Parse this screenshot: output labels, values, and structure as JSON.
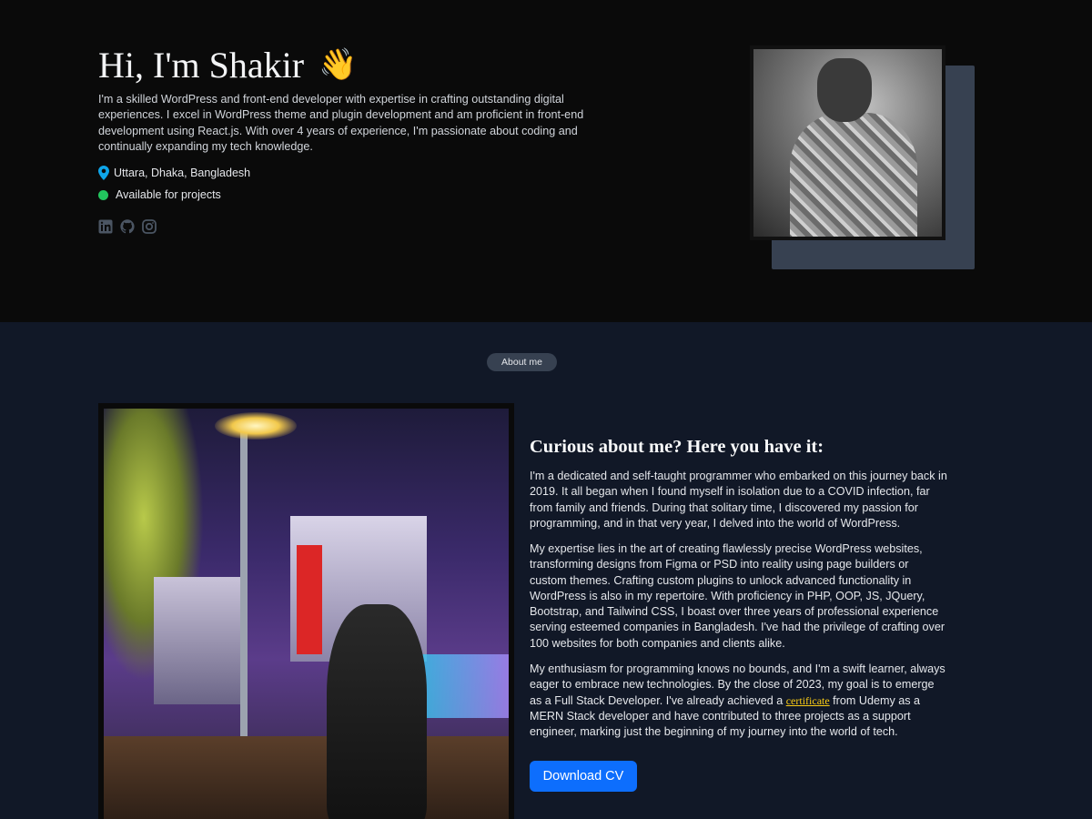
{
  "hero": {
    "title": "Hi, I'm Shakir",
    "wave_emoji": "👋",
    "description": "I'm a skilled WordPress and front-end developer with expertise in crafting outstanding digital experiences. I excel in WordPress theme and plugin development and am proficient in front-end development using React.js. With over 4 years of experience, I'm passionate about coding and continually expanding my tech knowledge.",
    "location": "Uttara, Dhaka, Bangladesh",
    "availability": "Available for projects",
    "socials": [
      {
        "icon": "linkedin-icon"
      },
      {
        "icon": "github-icon"
      },
      {
        "icon": "instagram-icon"
      }
    ]
  },
  "about": {
    "pill": "About me",
    "heading": "Curious about me? Here you have it:",
    "p1": "I'm a dedicated and self-taught programmer who embarked on this journey back in 2019. It all began when I found myself in isolation due to a COVID infection, far from family and friends. During that solitary time, I discovered my passion for programming, and in that very year, I delved into the world of WordPress.",
    "p2": "My expertise lies in the art of creating flawlessly precise WordPress websites, transforming designs from Figma or PSD into reality using page builders or custom themes. Crafting custom plugins to unlock advanced functionality in WordPress is also in my repertoire. With proficiency in PHP, OOP, JS, JQuery, Bootstrap, and Tailwind CSS, I boast over three years of professional experience serving esteemed companies in Bangladesh. I've had the privilege of crafting over 100 websites for both companies and clients alike.",
    "p3_before": "My enthusiasm for programming knows no bounds, and I'm a swift learner, always eager to embrace new technologies. By the close of 2023, my goal is to emerge as a Full Stack Developer. I've already achieved a ",
    "p3_link": "certificate",
    "p3_after": " from Udemy as a MERN Stack developer and have contributed to three projects as a support engineer, marking just the beginning of my journey into the world of tech.",
    "cv_button": "Download CV"
  },
  "colors": {
    "hero_bg": "#0a0a0a",
    "about_bg": "#111827",
    "accent_button": "#0d6efd",
    "available_dot": "#22c55e",
    "location_pin": "#0ea5e9",
    "link": "#facc15"
  }
}
